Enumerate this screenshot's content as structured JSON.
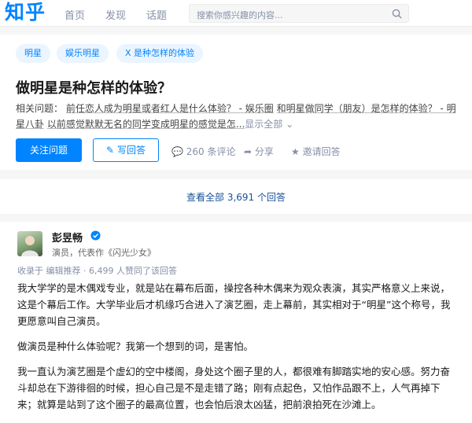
{
  "header": {
    "logo": "知乎",
    "nav": [
      "首页",
      "发现",
      "话题"
    ],
    "search_placeholder": "搜索你感兴趣的内容..."
  },
  "question": {
    "tags": [
      "明星",
      "娱乐明星",
      "X 是种怎样的体验"
    ],
    "title": "做明星是种怎样的体验？",
    "related_label": "相关问题：",
    "related": [
      "前任恋人成为明星或者红人是什么体验？ - 娱乐圈",
      "和明星做同学（朋友）是怎样的体验？ - 明星八卦",
      "以前感觉默默无名的同学变成明星的感觉是怎..."
    ],
    "show_all": "显示全部",
    "follow_button": "关注问题",
    "write_button": "写回答",
    "comments": "260 条评论",
    "share": "分享",
    "invite": "邀请回答"
  },
  "view_all": "查看全部 3,691 个回答",
  "answer": {
    "author": "彭昱畅",
    "headline": "演员，代表作《闪光少女》",
    "meta": "收录于 编辑推荐 · 6,499 人赞同了该回答",
    "paragraphs": [
      "我大学学的是木偶戏专业，就是站在幕布后面，操控各种木偶来为观众表演，其实严格意义上来说，这是个幕后工作。大学毕业后才机缘巧合进入了演艺圈，走上幕前，其实相对于“明星”这个称号，我更愿意叫自己演员。",
      "做演员是种什么体验呢？我第一个想到的词，是害怕。",
      "我一直认为演艺圈是个虚幻的空中楼阁，身处这个圈子里的人，都很难有脚踏实地的安心感。努力奋斗却总在下游徘徊的时候，担心自己是不是走错了路；刚有点起色，又怕作品跟不上，人气再掉下来；就算是站到了这个圈子的最高位置，也会怕后浪太凶猛，把前浪拍死在沙滩上。"
    ]
  },
  "colors": {
    "brand": "#0084ff",
    "link": "#175199",
    "muted": "#8590a6"
  }
}
